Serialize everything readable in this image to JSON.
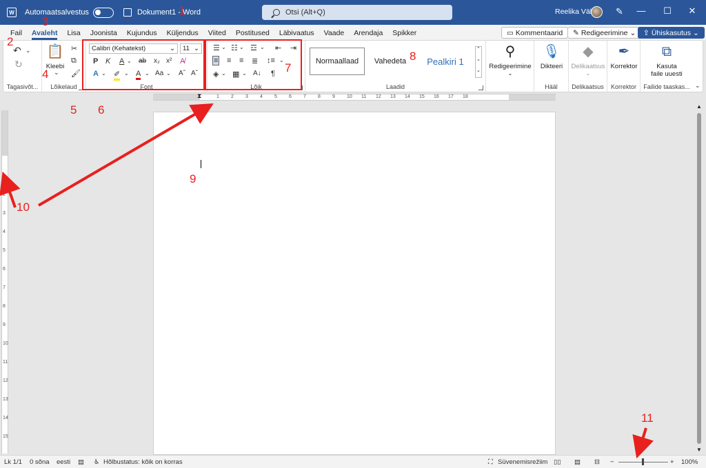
{
  "titlebar": {
    "autosave_label": "Automaatsalvestus",
    "document_title": "Dokument1 - Word",
    "search_placeholder": "Otsi (Alt+Q)",
    "user_name": "Reelika Väli"
  },
  "tabs": [
    "Fail",
    "Avaleht",
    "Lisa",
    "Joonista",
    "Kujundus",
    "Küljendus",
    "Viited",
    "Postitused",
    "Läbivaatus",
    "Vaade",
    "Arendaja",
    "Spikker"
  ],
  "active_tab": "Avaleht",
  "topright": {
    "comments": "Kommentaarid",
    "editing": "Redigeerimine",
    "share": "Ühiskasutus"
  },
  "ribbon": {
    "undo_group": "Tagasivõt...",
    "clipboard_group": "Lõikelaud",
    "paste_label": "Kleebi",
    "font_group": "Font",
    "font_name": "Calibri (Kehatekst)",
    "font_size": "11",
    "bold": "P",
    "italic": "K",
    "paragraph_group": "Lõik",
    "styles_group": "Laadid",
    "style_normal": "Normaallaad",
    "style_nospace": "Vahedeta",
    "style_heading1": "Pealkiri 1",
    "editing_label": "Redigeerimine",
    "dictate_label": "Dikteeri",
    "voice_group": "Hääl",
    "sensitivity_label": "Delikaatsus",
    "sensitivity_group": "Delikaatsus",
    "editor_label": "Korrektor",
    "editor_group": "Korrektor",
    "reuse_label_1": "Kasuta",
    "reuse_label_2": "faile uuesti",
    "reuse_group": "Failide taaskas..."
  },
  "ruler_h_labels": [
    "1",
    "2",
    "3",
    "4",
    "5",
    "6",
    "7",
    "8",
    "9",
    "10",
    "11",
    "12",
    "13",
    "14",
    "15",
    "16",
    "17",
    "18"
  ],
  "ruler_v_labels": [
    "1",
    "2",
    "3",
    "4",
    "5",
    "6",
    "7",
    "8",
    "9",
    "10",
    "11",
    "12",
    "13",
    "14",
    "15"
  ],
  "statusbar": {
    "page": "Lk 1/1",
    "words": "0 sõna",
    "language": "eesti",
    "accessibility": "Hõlbustatus: kõik on korras",
    "focus": "Süvenemisrežiim",
    "zoom": "100%"
  },
  "annotations": [
    "1",
    "2",
    "3",
    "4",
    "5",
    "6",
    "7",
    "8",
    "9",
    "10",
    "11"
  ],
  "colors": {
    "word_blue": "#2b579a",
    "annotation_red": "#e8201e"
  }
}
